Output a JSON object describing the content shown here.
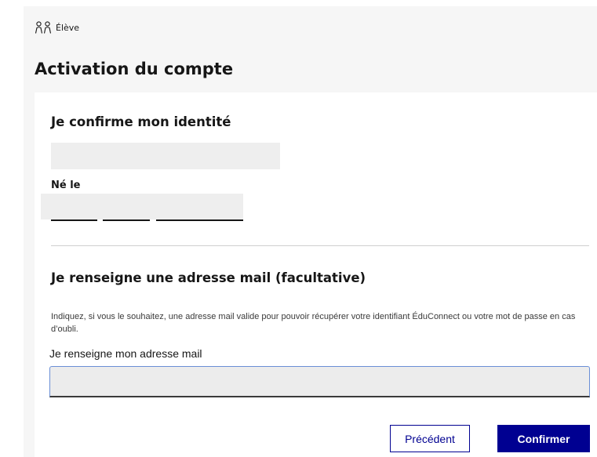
{
  "header": {
    "role_icon": "users-icon",
    "role_label": "Élève",
    "title": "Activation du compte"
  },
  "identity": {
    "heading": "Je confirme mon identité",
    "born_label": "Né le"
  },
  "email_section": {
    "heading": "Je renseigne une adresse mail (facultative)",
    "hint": "Indiquez, si vous le souhaitez, une adresse mail valide pour pouvoir récupérer votre identifiant ÉduConnect ou votre mot de passe en cas d’oubli.",
    "field_label": "Je renseigne mon adresse mail",
    "field_value": ""
  },
  "actions": {
    "previous_label": "Précédent",
    "confirm_label": "Confirmer"
  },
  "colors": {
    "primary": "#000091",
    "background": "#f6f6f6"
  }
}
